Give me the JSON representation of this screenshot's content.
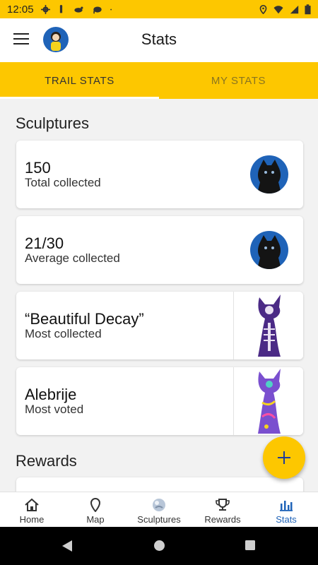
{
  "status_bar": {
    "time": "12:05"
  },
  "app_bar": {
    "title": "Stats"
  },
  "tabs": [
    {
      "label": "TRAIL STATS",
      "active": true
    },
    {
      "label": "MY STATS",
      "active": false
    }
  ],
  "sections": {
    "sculptures_title": "Sculptures",
    "rewards_title": "Rewards"
  },
  "cards": [
    {
      "value": "150",
      "label": "Total collected",
      "thumb": "black-cat-icon"
    },
    {
      "value": "21/30",
      "label": "Average collected",
      "thumb": "black-cat-icon"
    },
    {
      "value": "“Beautiful Decay”",
      "label": "Most collected",
      "thumb": "skeleton-cat-sculpture-icon"
    },
    {
      "value": "Alebrije",
      "label": "Most voted",
      "thumb": "alebrije-cat-sculpture-icon"
    }
  ],
  "fab": {
    "icon": "plus-icon"
  },
  "bottom_nav": [
    {
      "label": "Home",
      "icon": "home-icon",
      "active": false
    },
    {
      "label": "Map",
      "icon": "map-pin-icon",
      "active": false
    },
    {
      "label": "Sculptures",
      "icon": "sculpture-globe-icon",
      "active": false
    },
    {
      "label": "Rewards",
      "icon": "trophy-icon",
      "active": false
    },
    {
      "label": "Stats",
      "icon": "bar-chart-icon",
      "active": true
    }
  ],
  "colors": {
    "accent": "#fdc700",
    "active_nav": "#1f63b8",
    "avatar_bg": "#1f63b8"
  }
}
